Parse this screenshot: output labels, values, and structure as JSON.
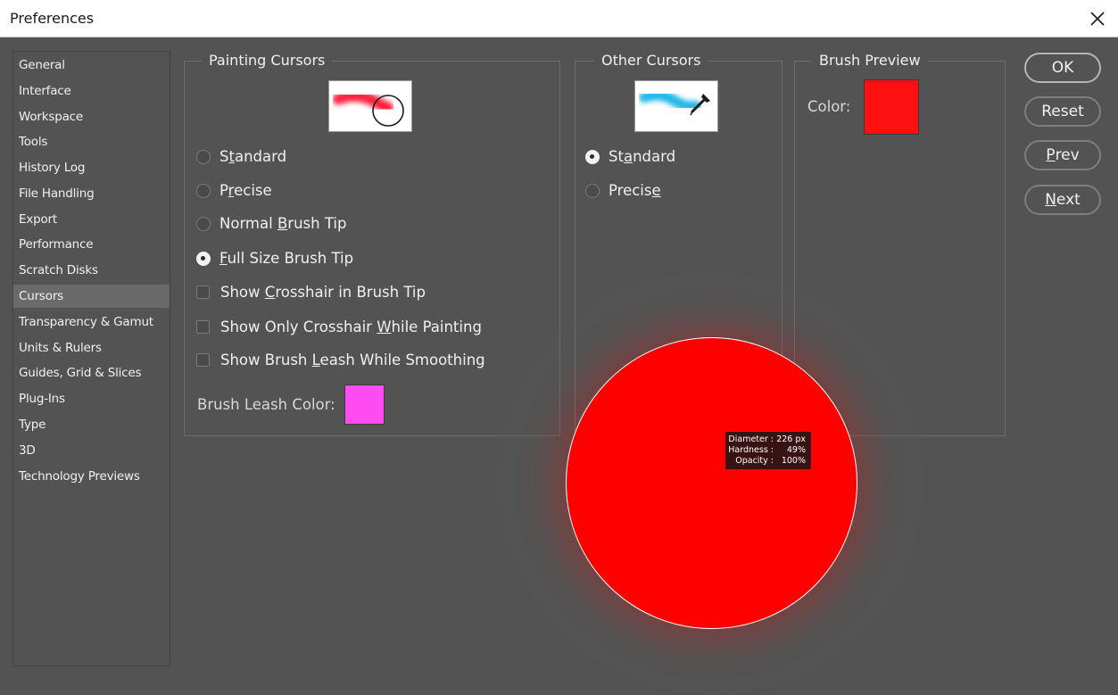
{
  "window": {
    "title": "Preferences"
  },
  "sidebar": {
    "items": [
      {
        "label": "General"
      },
      {
        "label": "Interface"
      },
      {
        "label": "Workspace"
      },
      {
        "label": "Tools"
      },
      {
        "label": "History Log"
      },
      {
        "label": "File Handling"
      },
      {
        "label": "Export"
      },
      {
        "label": "Performance"
      },
      {
        "label": "Scratch Disks"
      },
      {
        "label": "Cursors",
        "selected": true
      },
      {
        "label": "Transparency & Gamut"
      },
      {
        "label": "Units & Rulers"
      },
      {
        "label": "Guides, Grid & Slices"
      },
      {
        "label": "Plug-Ins"
      },
      {
        "label": "Type"
      },
      {
        "label": "3D"
      },
      {
        "label": "Technology Previews"
      }
    ]
  },
  "painting_cursors": {
    "title": "Painting Cursors",
    "options": [
      {
        "pre": "S",
        "mn": "t",
        "post": "andard",
        "checked": false
      },
      {
        "pre": "P",
        "mn": "r",
        "post": "ecise",
        "checked": false
      },
      {
        "pre": "Normal ",
        "mn": "B",
        "post": "rush Tip",
        "checked": false
      },
      {
        "pre": "",
        "mn": "F",
        "post": "ull Size Brush Tip",
        "checked": true
      }
    ],
    "checkboxes": [
      {
        "pre": "Show ",
        "mn": "C",
        "post": "rosshair in Brush Tip",
        "checked": false
      },
      {
        "pre": "Show Only Crosshair ",
        "mn": "W",
        "post": "hile Painting",
        "checked": false
      },
      {
        "pre": "Show Brush ",
        "mn": "L",
        "post": "eash While Smoothing",
        "checked": false
      }
    ],
    "leash_color_label": "Brush Leash Color:",
    "leash_color": "#ff4cf2"
  },
  "other_cursors": {
    "title": "Other Cursors",
    "options": [
      {
        "pre": "St",
        "mn": "a",
        "post": "ndard",
        "checked": true
      },
      {
        "pre": "Precis",
        "mn": "e",
        "post": "",
        "checked": false
      }
    ]
  },
  "brush_preview": {
    "title": "Brush Preview",
    "color_label": "Color:",
    "color": "#ff1010"
  },
  "buttons": {
    "ok": {
      "pre": "OK",
      "mn": "",
      "post": ""
    },
    "reset": {
      "pre": "Reset",
      "mn": "",
      "post": ""
    },
    "prev": {
      "pre": "",
      "mn": "P",
      "post": "rev"
    },
    "next": {
      "pre": "",
      "mn": "N",
      "post": "ext"
    }
  },
  "brush_hud": {
    "diameter_label": "Diameter :",
    "diameter_value": "226 px",
    "hardness_label": "Hardness :",
    "hardness_value": "49%",
    "opacity_label": "Opacity :",
    "opacity_value": "100%"
  },
  "icons": {
    "close": "close-icon",
    "painting_preview": "brush-stroke-circle-cursor-icon",
    "other_preview": "eyedropper-stroke-icon"
  }
}
